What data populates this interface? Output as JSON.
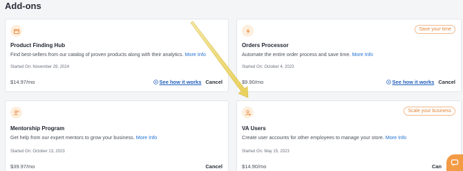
{
  "page": {
    "title": "Add-ons"
  },
  "cards": [
    {
      "icon": "box-icon",
      "title": "Product Finding Hub",
      "description": "Find best-sellers from our catalog of proven products along with their analytics.",
      "more_info": "More Info",
      "started": "Started On: November 29, 2024",
      "price": "$14.97/mo",
      "how_label": "See how it works",
      "cancel_label": "Cancel",
      "badge": ""
    },
    {
      "icon": "lightning-icon",
      "title": "Orders Processor",
      "description": "Automate the entire order process and save time.",
      "more_info": "More Info",
      "started": "Started On: October 4, 2023",
      "price": "$9.90/mo",
      "how_label": "See how it works",
      "cancel_label": "Cancel",
      "badge": "Save your time"
    },
    {
      "icon": "mentorship-icon",
      "title": "Mentorship Program",
      "description": "Get help from our expert mentors to grow your business.",
      "more_info": "More Info",
      "started": "Started On: October 13, 2023",
      "price": "$39.97/mo",
      "cancel_label": "Cancel",
      "badge": ""
    },
    {
      "icon": "user-add-icon",
      "title": "VA Users",
      "description": "Create user accounts for other employees to manage your store.",
      "more_info": "More Info",
      "started": "Started On: May 15, 2023",
      "price": "$14.90/mo",
      "cancel_label": "Can",
      "badge": "Scale your business"
    }
  ],
  "colors": {
    "accent": "#f39a45",
    "link": "#1f6fd1",
    "badge": "#e0863a"
  }
}
